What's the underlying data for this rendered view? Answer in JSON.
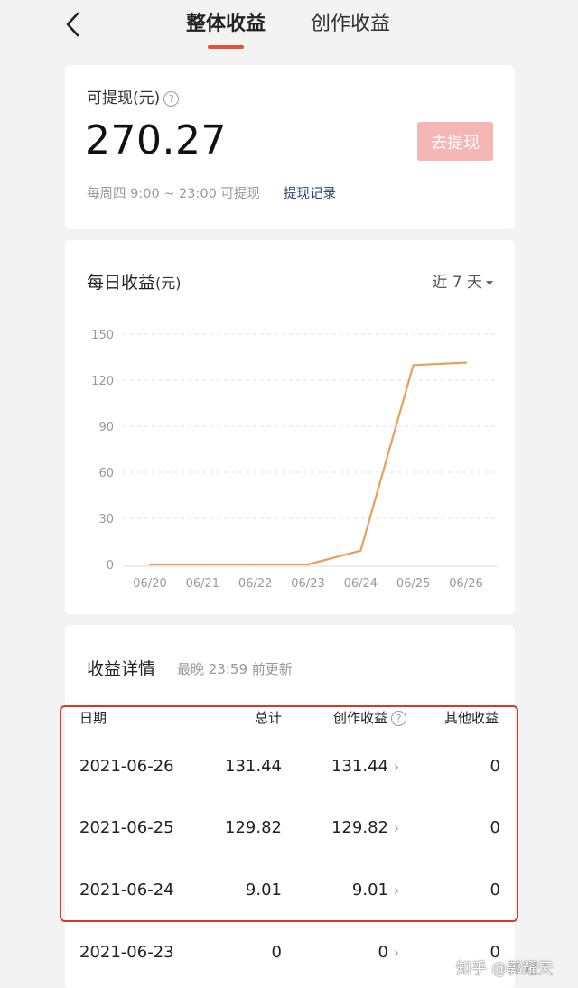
{
  "header": {
    "tabs": [
      {
        "label": "整体收益",
        "active": true
      },
      {
        "label": "创作收益",
        "active": false
      }
    ],
    "back_icon": "chevron-left-icon"
  },
  "balance": {
    "label": "可提现(元)",
    "help_icon": "question-circle-icon",
    "amount": "270.27",
    "button_label": "去提现",
    "note": "每周四 9:00 ~ 23:00 可提现",
    "record_link": "提现记录"
  },
  "daily": {
    "title": "每日收益",
    "unit": "(元)",
    "range": "近 7 天"
  },
  "chart_data": {
    "type": "line",
    "x": [
      "06/20",
      "06/21",
      "06/22",
      "06/23",
      "06/24",
      "06/25",
      "06/26"
    ],
    "series": [
      {
        "values": [
          0,
          0,
          0,
          0,
          9.01,
          129.82,
          131.44
        ],
        "color": "#e8a15a"
      }
    ],
    "y_ticks": [
      "150",
      "120",
      "90",
      "60",
      "30",
      "0"
    ],
    "ylim": [
      0,
      150
    ],
    "grid": true
  },
  "detail": {
    "title": "收益详情",
    "subtitle": "最晚 23:59 前更新",
    "columns": [
      "日期",
      "总计",
      "创作收益",
      "其他收益"
    ],
    "rows": [
      {
        "date": "2021-06-26",
        "total": "131.44",
        "creation": "131.44",
        "other": "0"
      },
      {
        "date": "2021-06-25",
        "total": "129.82",
        "creation": "129.82",
        "other": "0"
      },
      {
        "date": "2021-06-24",
        "total": "9.01",
        "creation": "9.01",
        "other": "0"
      },
      {
        "date": "2021-06-23",
        "total": "0",
        "creation": "0",
        "other": "0"
      }
    ]
  },
  "watermark": "知乎 @郭耀天",
  "colors": {
    "accent": "#e2533c",
    "line": "#e8a15a",
    "highlight": "#d23a2e",
    "button": "#f4b7b5"
  }
}
